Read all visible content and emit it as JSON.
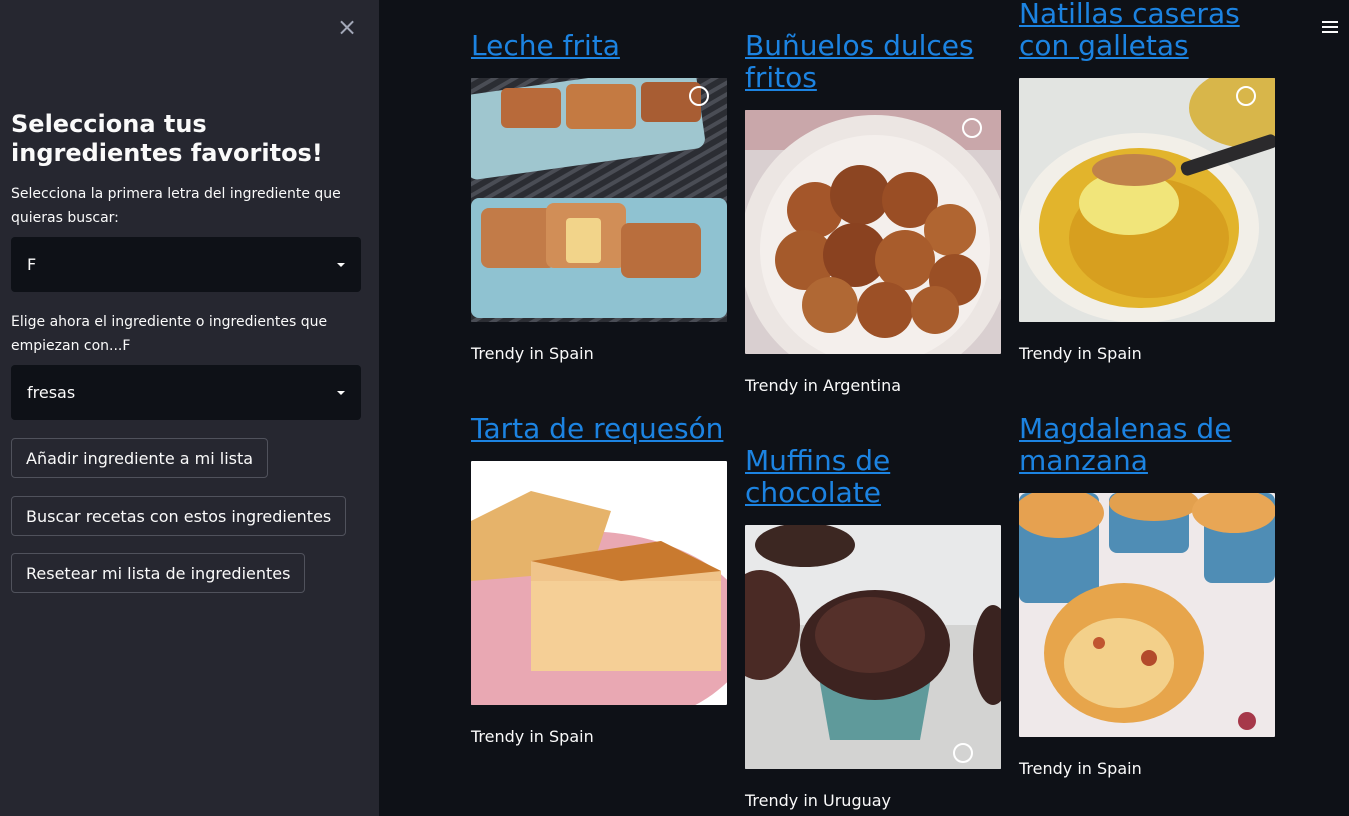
{
  "sidebar": {
    "close_symbol": "×",
    "title": "Selecciona tus ingredientes favoritos!",
    "letter_label": "Selecciona la primera letra del ingrediente que quieras buscar:",
    "letter_value": "F",
    "ingredient_label": "Elige ahora el ingrediente o ingredientes que empiezan con...F",
    "ingredient_value": "fresas",
    "buttons": {
      "add": "Añadir ingrediente a mi lista",
      "search": "Buscar recetas con estos ingredientes",
      "reset": "Resetear mi lista de ingredientes"
    }
  },
  "recipes": [
    {
      "title": "Leche frita",
      "caption": "Trendy in Spain",
      "image": "leche-frita-photo"
    },
    {
      "title": "Buñuelos dulces fritos",
      "caption": "Trendy in Argentina",
      "image": "bunuelos-photo"
    },
    {
      "title": "Natillas caseras con galletas",
      "caption": "Trendy in Spain",
      "image": "natillas-photo"
    },
    {
      "title": "Tarta de requesón",
      "caption": "Trendy in Spain",
      "image": "tarta-requeson-photo"
    },
    {
      "title": "Muffins de chocolate",
      "caption": "Trendy in Uruguay",
      "image": "muffins-photo"
    },
    {
      "title": "Magdalenas de manzana",
      "caption": "Trendy in Spain",
      "image": "magdalenas-photo"
    }
  ],
  "icons": {
    "menu": "hamburger-menu-icon",
    "close": "close-icon",
    "dropdown": "chevron-down-icon"
  },
  "colors": {
    "link": "#1c83e1",
    "sidebar_bg": "#262730",
    "main_bg": "#0e1117"
  }
}
